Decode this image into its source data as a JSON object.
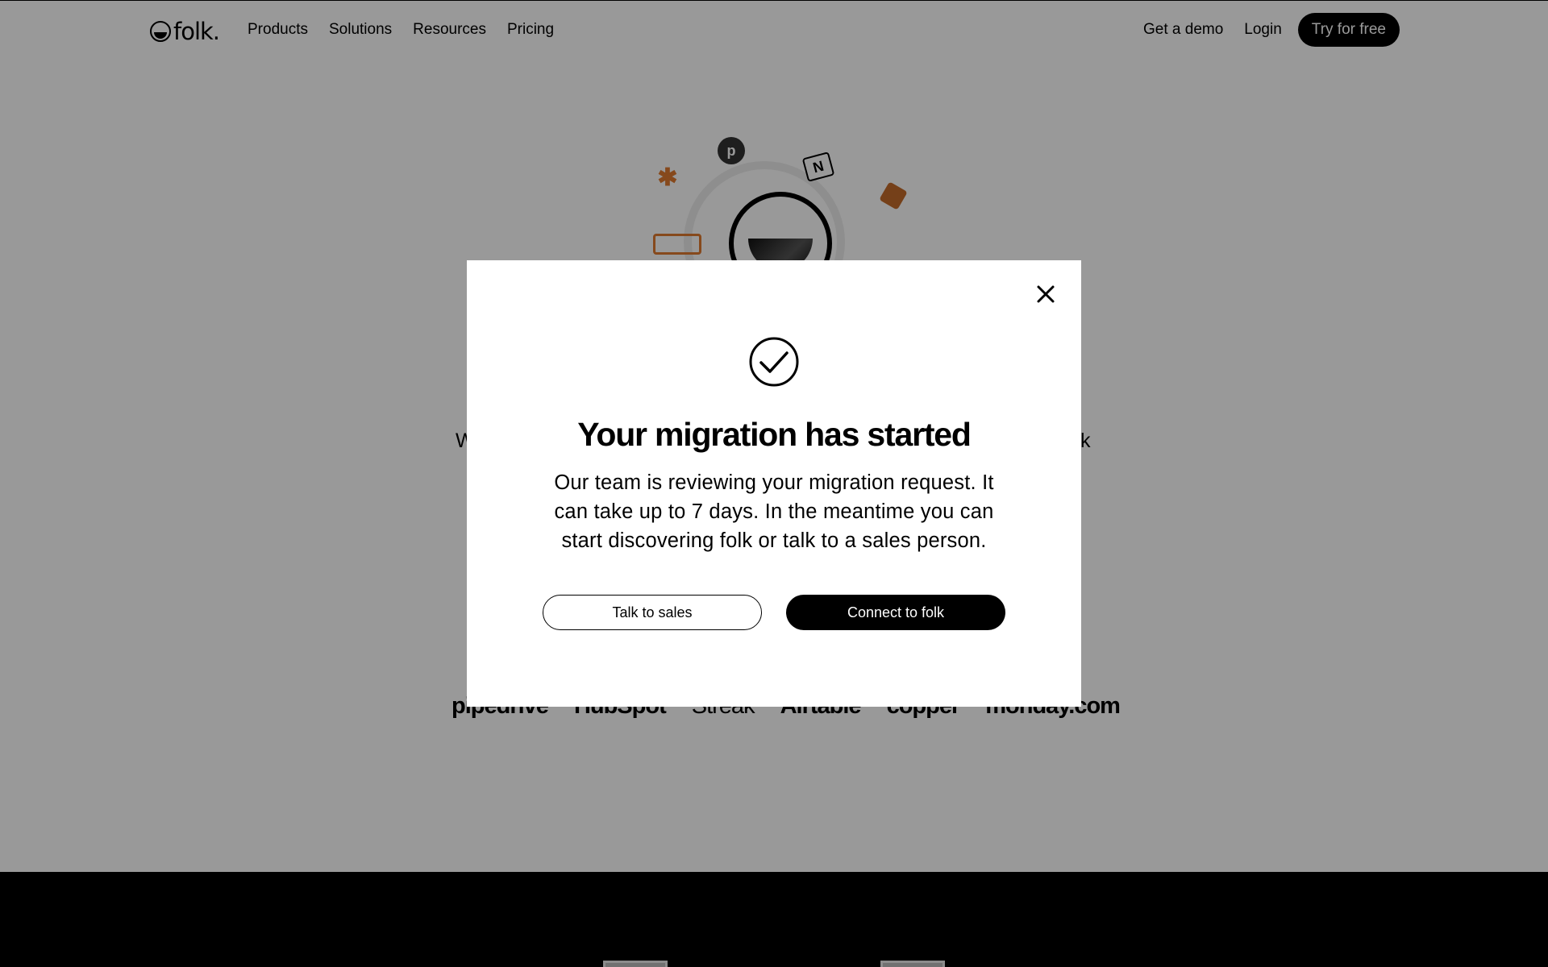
{
  "nav": {
    "logo_text": "folk.",
    "links": [
      "Products",
      "Solutions",
      "Resources",
      "Pricing"
    ],
    "demo": "Get a demo",
    "login": "Login",
    "try_free": "Try for free"
  },
  "behind": {
    "left_char": "W",
    "right_char": "k",
    "logos": [
      "pipedrive",
      "HubSpot",
      "Streak",
      "Airtable",
      "copper",
      "monday.com"
    ]
  },
  "modal": {
    "title": "Your migration has started",
    "description": "Our team is reviewing your migration request. It can take up to 7 days. In the meantime you can start discovering folk or talk to a sales person.",
    "talk_to_sales": "Talk to sales",
    "connect": "Connect to folk",
    "icons": [
      "close-icon",
      "check-circle-icon"
    ]
  },
  "colors": {
    "overlay": "rgba(0,0,0,0.4)",
    "primary": "#000000",
    "surface": "#ffffff"
  }
}
